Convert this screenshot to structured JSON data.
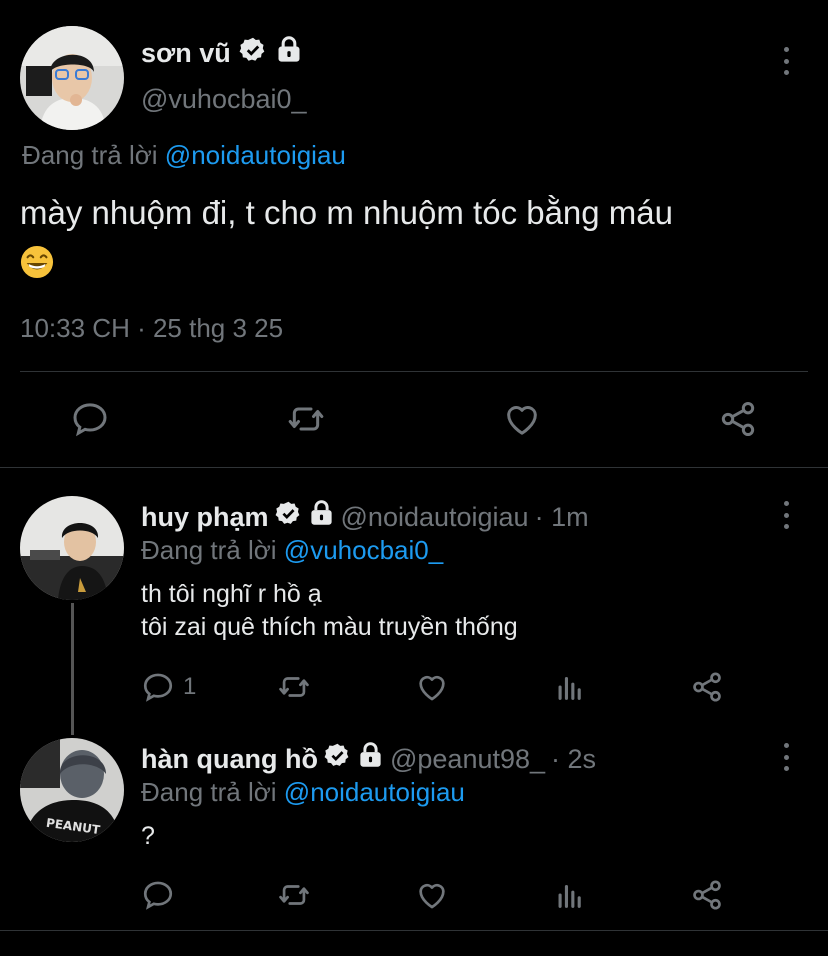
{
  "main_tweet": {
    "author_name": "sơn vũ",
    "author_handle": "@vuhocbai0_",
    "replying_prefix": "Đang trả lời",
    "replying_to": "@noidautoigiau",
    "text": "mày nhuộm đi, t cho m nhuộm tóc bằng máu",
    "emoji": "grinning-face-with-smiling-eyes",
    "timestamp": "10:33 CH · 25 thg 3 25"
  },
  "replies": [
    {
      "author_name": "huy phạm",
      "author_handle": "@noidautoigiau",
      "time": "· 1m",
      "replying_prefix": "Đang trả lời",
      "replying_to": "@vuhocbai0_",
      "text_line1": "th tôi nghĩ r hồ ạ",
      "text_line2": "tôi zai quê thích màu truyền thống",
      "reply_count": "1"
    },
    {
      "author_name": "hàn quang hồ",
      "author_handle": "@peanut98_",
      "time": "· 2s",
      "replying_prefix": "Đang trả lời",
      "replying_to": "@noidautoigiau",
      "text_line1": "?",
      "text_line2": "",
      "reply_count": ""
    }
  ],
  "colors": {
    "background": "#000000",
    "text": "#e7e9ea",
    "muted": "#71767b",
    "accent": "#1d9bf0",
    "divider": "#2f3336"
  }
}
